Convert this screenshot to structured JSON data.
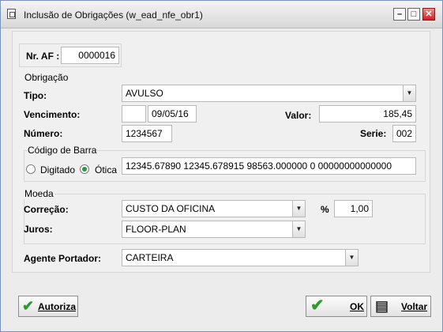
{
  "window": {
    "title": "Inclusão de Obrigações (w_ead_nfe_obr1)"
  },
  "af": {
    "label": "Nr. AF :",
    "value": "0000016"
  },
  "obrigacao": {
    "group_label": "Obrigação",
    "tipo_label": "Tipo:",
    "tipo_value": "AVULSO",
    "vencimento_label": "Vencimento:",
    "vencimento_prefix": "",
    "vencimento_value": "09/05/16",
    "valor_label": "Valor:",
    "valor_value": "185,45",
    "numero_label": "Número:",
    "numero_value": "1234567",
    "serie_label": "Serie:",
    "serie_value": "002"
  },
  "codigo_barra": {
    "group_label": "Código de Barra",
    "radio_digitado": "Digitado",
    "radio_otica": "Ótica",
    "selected": "Ótica",
    "value": "12345.67890 12345.678915 98563.000000 0 00000000000000"
  },
  "moeda": {
    "group_label": "Moeda",
    "correcao_label": "Correção:",
    "correcao_value": "CUSTO DA OFICINA",
    "percent_label": "%",
    "percent_value": "1,00",
    "juros_label": "Juros:",
    "juros_value": "FLOOR-PLAN"
  },
  "agente": {
    "label": "Agente Portador:",
    "value": "CARTEIRA"
  },
  "buttons": {
    "autoriza": "Autoriza",
    "ok": "OK",
    "voltar": "Voltar"
  }
}
